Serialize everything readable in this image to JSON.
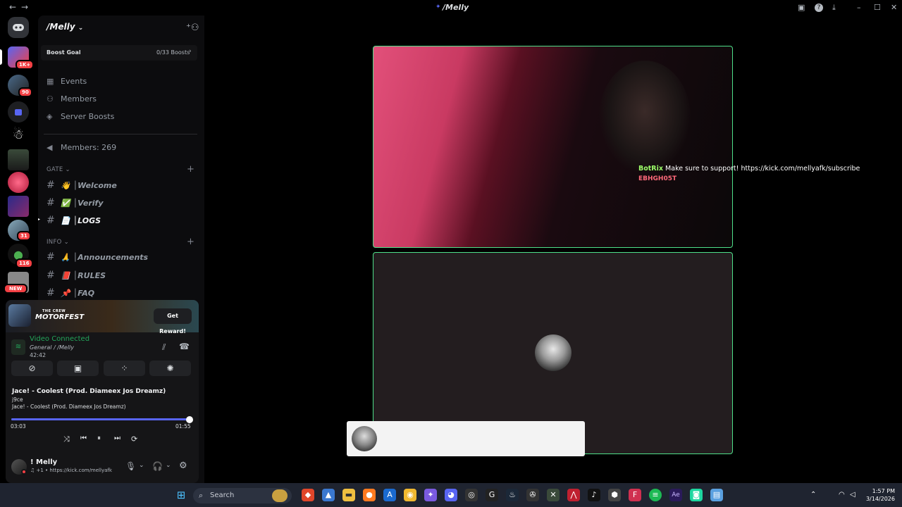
{
  "window": {
    "title": "/Melly",
    "back_icon": "←",
    "forward_icon": "→"
  },
  "rail": {
    "badges": [
      "1K+",
      "90",
      "31",
      "116"
    ],
    "new_label": "NEW"
  },
  "server": {
    "name": "/Melly",
    "boost_goal_label": "Boost Goal",
    "boost_goal_value": "0/33 Boosts",
    "menu": {
      "events": "Events",
      "members": "Members",
      "server_boosts": "Server Boosts",
      "member_count": "Members: 269"
    },
    "categories": [
      {
        "name": "GATE",
        "channels": [
          {
            "emoji": "👋",
            "name": "│Welcome"
          },
          {
            "emoji": "✅",
            "name": "│Verify"
          },
          {
            "emoji": "📄",
            "name": "│LOGS"
          }
        ]
      },
      {
        "name": "INFO",
        "channels": [
          {
            "emoji": "🙏",
            "name": "│Announcements"
          },
          {
            "emoji": "📕",
            "name": "│RULES"
          },
          {
            "emoji": "📌",
            "name": "│FAQ"
          }
        ]
      }
    ]
  },
  "promo": {
    "game_line1": "THE CREW",
    "game_line2": "MOTORFEST",
    "button": "Get Reward!"
  },
  "voice": {
    "status": "Video Connected",
    "channel": "General / /Melly",
    "duration": "42:42"
  },
  "music": {
    "title": "Jace! - Coolest (Prod. Diameex Jos Dreamz)",
    "artist": "j9ce",
    "album": "Jace! - Coolest (Prod. Diameex Jos Dreamz)",
    "elapsed": "03:03",
    "total": "01:55",
    "progress": 1.0
  },
  "user": {
    "name": "! Melly",
    "status": "♫ +1 • https://kick.com/mellyafk"
  },
  "overlay": {
    "bot_name": "BotRix",
    "bot_message": "Make sure to support! https://kick.com/mellyafk/subscribe",
    "second_user": "EBHGH05T"
  },
  "taskbar": {
    "search": "Search",
    "time": "1:57 PM",
    "date": "3/14/2026"
  },
  "colors": {
    "accent_green": "#4ee089",
    "discord_blurple": "#5865f2",
    "badge_red": "#f23f43"
  }
}
